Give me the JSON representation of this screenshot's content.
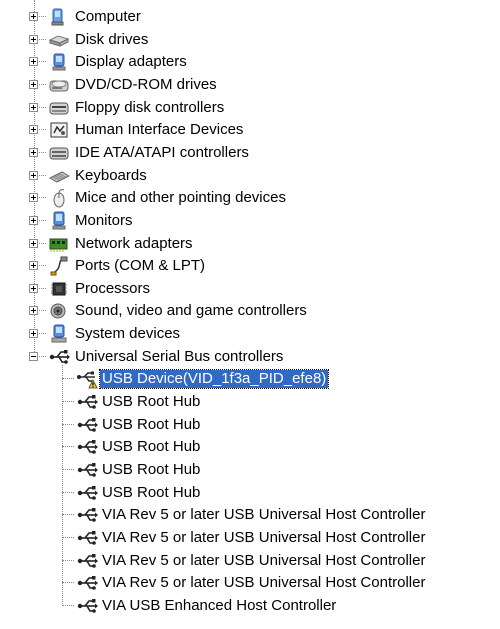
{
  "categories": [
    {
      "label": "Computer",
      "icon": "computer-icon",
      "expanded": false
    },
    {
      "label": "Disk drives",
      "icon": "disk-drive-icon",
      "expanded": false
    },
    {
      "label": "Display adapters",
      "icon": "display-adapter-icon",
      "expanded": false
    },
    {
      "label": "DVD/CD-ROM drives",
      "icon": "dvd-drive-icon",
      "expanded": false
    },
    {
      "label": "Floppy disk controllers",
      "icon": "floppy-controller-icon",
      "expanded": false
    },
    {
      "label": "Human Interface Devices",
      "icon": "hid-icon",
      "expanded": false
    },
    {
      "label": "IDE ATA/ATAPI controllers",
      "icon": "ide-controller-icon",
      "expanded": false
    },
    {
      "label": "Keyboards",
      "icon": "keyboard-icon",
      "expanded": false
    },
    {
      "label": "Mice and other pointing devices",
      "icon": "mouse-icon",
      "expanded": false
    },
    {
      "label": "Monitors",
      "icon": "monitor-icon",
      "expanded": false
    },
    {
      "label": "Network adapters",
      "icon": "network-adapter-icon",
      "expanded": false
    },
    {
      "label": "Ports (COM & LPT)",
      "icon": "port-icon",
      "expanded": false
    },
    {
      "label": "Processors",
      "icon": "processor-icon",
      "expanded": false
    },
    {
      "label": "Sound, video and game controllers",
      "icon": "speaker-icon",
      "expanded": false
    },
    {
      "label": "System devices",
      "icon": "system-devices-icon",
      "expanded": false
    },
    {
      "label": "Universal Serial Bus controllers",
      "icon": "usb-icon",
      "expanded": true
    }
  ],
  "usb_children": [
    {
      "label": "USB Device(VID_1f3a_PID_efe8)",
      "icon": "usb-warning-icon",
      "selected": true
    },
    {
      "label": "USB Root Hub",
      "icon": "usb-icon",
      "selected": false
    },
    {
      "label": "USB Root Hub",
      "icon": "usb-icon",
      "selected": false
    },
    {
      "label": "USB Root Hub",
      "icon": "usb-icon",
      "selected": false
    },
    {
      "label": "USB Root Hub",
      "icon": "usb-icon",
      "selected": false
    },
    {
      "label": "USB Root Hub",
      "icon": "usb-icon",
      "selected": false
    },
    {
      "label": "VIA Rev 5 or later USB Universal Host Controller",
      "icon": "usb-icon",
      "selected": false
    },
    {
      "label": "VIA Rev 5 or later USB Universal Host Controller",
      "icon": "usb-icon",
      "selected": false
    },
    {
      "label": "VIA Rev 5 or later USB Universal Host Controller",
      "icon": "usb-icon",
      "selected": false
    },
    {
      "label": "VIA Rev 5 or later USB Universal Host Controller",
      "icon": "usb-icon",
      "selected": false
    },
    {
      "label": "VIA USB Enhanced Host Controller",
      "icon": "usb-icon",
      "selected": false
    }
  ],
  "colors": {
    "selection": "#316ac5",
    "warning": "#f2d21b"
  }
}
